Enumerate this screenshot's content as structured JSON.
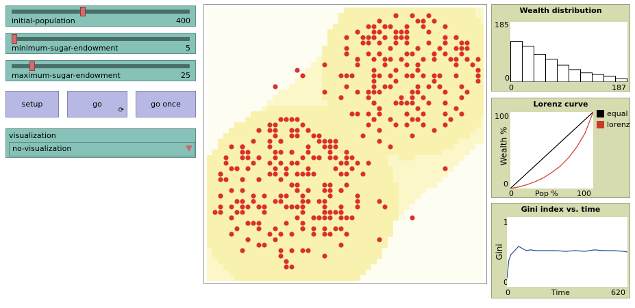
{
  "sliders": [
    {
      "label": "initial-population",
      "value": "400",
      "fraction": 0.39
    },
    {
      "label": "minimum-sugar-endowment",
      "value": "5",
      "fraction": 0.0
    },
    {
      "label": "maximum-sugar-endowment",
      "value": "25",
      "fraction": 0.1
    }
  ],
  "buttons": {
    "setup": "setup",
    "go": "go",
    "go_once": "go once",
    "forever_icon": "forever-icon"
  },
  "chooser": {
    "label": "visualization",
    "value": "no-visualization"
  },
  "colors": {
    "slider": "#86c2b8",
    "button": "#b8b8e4",
    "plot_bg": "#d6dbb0",
    "agent": "#d9302c",
    "sugar_light": "#fbf7c8",
    "sugar_mid": "#f8f2ae",
    "lorenz": "#cc3a2a",
    "gini": "#1f4f8f"
  },
  "plots": {
    "wealth": {
      "title": "Wealth distribution",
      "y_max": "185",
      "y_min": "0",
      "x_min": "0",
      "x_max": "187"
    },
    "lorenz": {
      "title": "Lorenz curve",
      "y_label": "Wealth %",
      "x_label": "Pop %",
      "y_max": "100",
      "y_min": "0",
      "x_min": "0",
      "x_max": "100",
      "legend": [
        "equal",
        "lorenz"
      ]
    },
    "gini": {
      "title": "Gini index vs. time",
      "y_label": "Gini",
      "x_label": "Time",
      "y_max": "1",
      "y_min": "0",
      "x_min": "0",
      "x_max": "620"
    }
  },
  "chart_data": [
    {
      "type": "bar",
      "title": "Wealth distribution",
      "xlim": [
        0,
        187
      ],
      "ylim": [
        0,
        185
      ],
      "values": [
        125,
        110,
        85,
        70,
        52,
        38,
        28,
        23,
        18,
        10
      ]
    },
    {
      "type": "line",
      "title": "Lorenz curve",
      "xlabel": "Pop %",
      "ylabel": "Wealth %",
      "xlim": [
        0,
        100
      ],
      "ylim": [
        0,
        100
      ],
      "series": [
        {
          "name": "equal",
          "x": [
            0,
            100
          ],
          "y": [
            0,
            100
          ]
        },
        {
          "name": "lorenz",
          "x": [
            0,
            10,
            20,
            30,
            40,
            50,
            60,
            70,
            80,
            90,
            100
          ],
          "y": [
            0,
            2,
            5,
            9,
            14,
            21,
            29,
            40,
            54,
            72,
            100
          ]
        }
      ]
    },
    {
      "type": "line",
      "title": "Gini index vs. time",
      "xlabel": "Time",
      "ylabel": "Gini",
      "xlim": [
        0,
        620
      ],
      "ylim": [
        0,
        1
      ],
      "series": [
        {
          "x": [
            0,
            10,
            20,
            40,
            60,
            80,
            100,
            120,
            150,
            200,
            250,
            300,
            350,
            400,
            450,
            500,
            550,
            600,
            620
          ],
          "y": [
            0.12,
            0.38,
            0.46,
            0.52,
            0.58,
            0.55,
            0.52,
            0.53,
            0.52,
            0.52,
            0.52,
            0.51,
            0.52,
            0.51,
            0.53,
            0.52,
            0.52,
            0.51,
            0.5
          ]
        }
      ]
    }
  ]
}
